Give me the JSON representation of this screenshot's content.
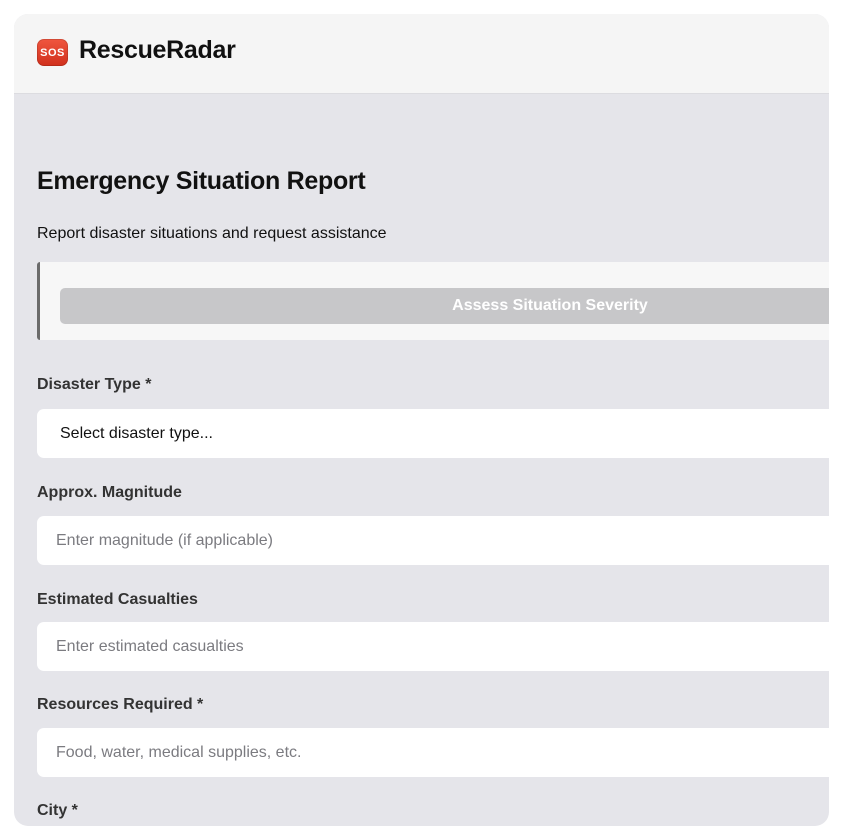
{
  "app": {
    "icon_text": "SOS",
    "name": "RescueRadar"
  },
  "page": {
    "title": "Emergency Situation Report",
    "subtitle": "Report disaster situations and request assistance"
  },
  "assess": {
    "button_label": "Assess Situation Severity"
  },
  "form": {
    "disaster_type": {
      "label": "Disaster Type *",
      "selected": "Select disaster type..."
    },
    "magnitude": {
      "label": "Approx. Magnitude",
      "placeholder": "Enter magnitude (if applicable)"
    },
    "casualties": {
      "label": "Estimated Casualties",
      "placeholder": "Enter estimated casualties"
    },
    "resources": {
      "label": "Resources Required *",
      "placeholder": "Food, water, medical supplies, etc."
    },
    "city": {
      "label": "City *"
    }
  }
}
